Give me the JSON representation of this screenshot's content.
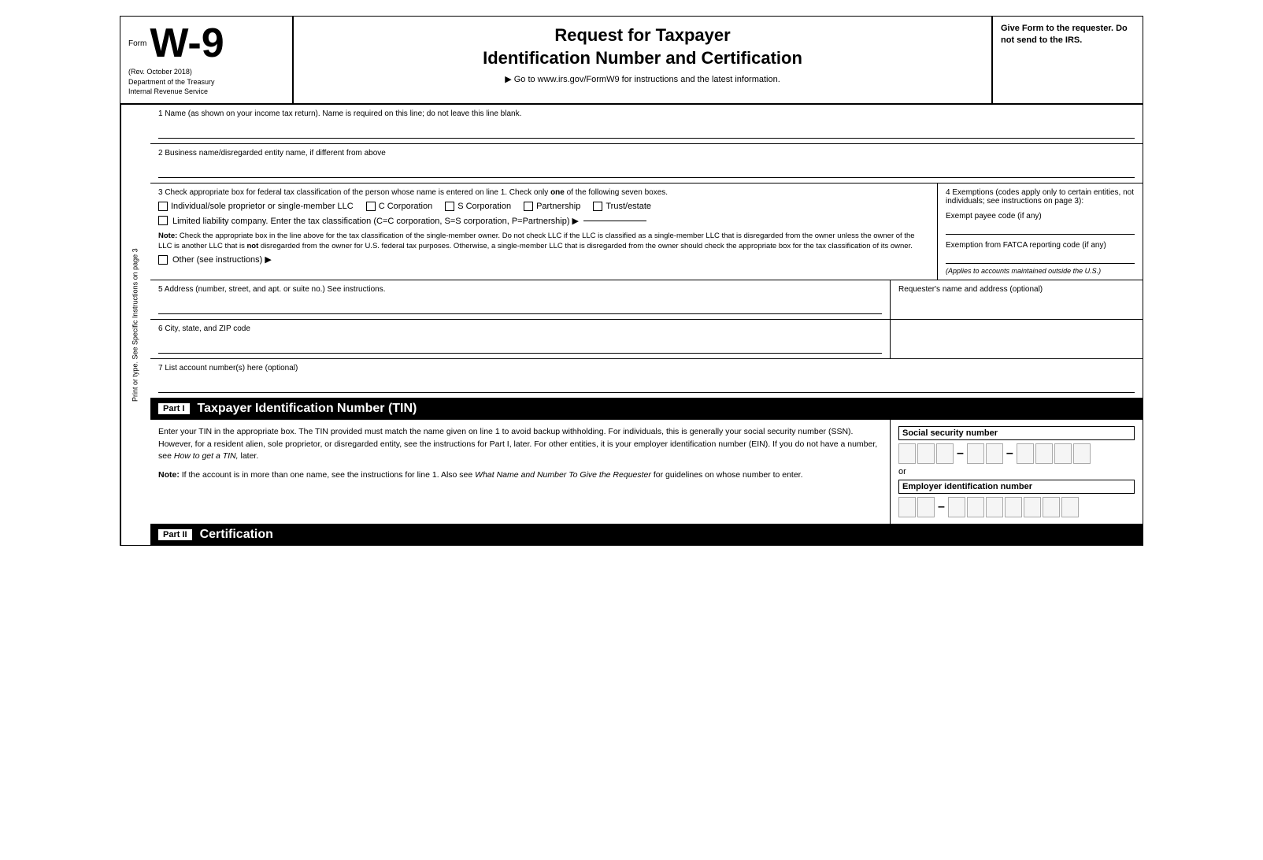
{
  "header": {
    "form_label": "Form",
    "form_number": "W-9",
    "rev": "(Rev. October 2018)",
    "dept1": "Department of the Treasury",
    "dept2": "Internal Revenue Service",
    "title_line1": "Request for Taxpayer",
    "title_line2": "Identification Number and Certification",
    "goto": "▶ Go to www.irs.gov/FormW9 for instructions and the latest information.",
    "give_form": "Give Form to the requester. Do not send to the IRS."
  },
  "sidebar": {
    "text": "Print or type. See Specific Instructions on page 3"
  },
  "fields": {
    "line1_label": "1  Name (as shown on your income tax return). Name is required on this line; do not leave this line blank.",
    "line2_label": "2  Business name/disregarded entity name, if different from above",
    "line3_label": "3  Check appropriate box for federal tax classification of the person whose name is entered on line 1. Check only",
    "line3_label_one": "one",
    "line3_label_end": "of the following seven boxes.",
    "cb_individual": "Individual/sole proprietor or single-member LLC",
    "cb_c_corp": "C Corporation",
    "cb_s_corp": "S Corporation",
    "cb_partnership": "Partnership",
    "cb_trust": "Trust/estate",
    "llc_label": "Limited liability company. Enter the tax classification (C=C corporation, S=S corporation, P=Partnership) ▶",
    "note_bold": "Note:",
    "note_text": " Check the appropriate box in the line above for the tax classification of the single-member owner.  Do not check LLC if the LLC is classified as a single-member LLC that is disregarded from the owner unless the owner of the LLC is another LLC that is",
    "note_not": "not",
    "note_text2": " disregarded from the owner for U.S. federal tax purposes. Otherwise, a single-member LLC that is disregarded from the owner should check the appropriate box for the tax classification of its owner.",
    "other_label": "Other (see instructions) ▶",
    "exemptions_label": "4  Exemptions (codes apply only to certain entities, not individuals; see instructions on page 3):",
    "exempt_payee_label": "Exempt payee code (if any)",
    "fatca_label": "Exemption from FATCA reporting code (if any)",
    "applies_note": "(Applies to accounts maintained outside the U.S.)",
    "line5_label": "5  Address (number, street, and apt. or suite no.) See instructions.",
    "requester_label": "Requester's name and address (optional)",
    "line6_label": "6  City, state, and ZIP code",
    "line7_label": "7  List account number(s) here (optional)"
  },
  "part1": {
    "badge": "Part I",
    "title": "Taxpayer Identification Number (TIN)",
    "body_text": "Enter your TIN in the appropriate box. The TIN provided must match the name given on line 1 to avoid backup withholding. For individuals, this is generally your social security number (SSN). However, for a resident alien, sole proprietor, or disregarded entity, see the instructions for Part I, later. For other entities, it is your employer identification number (EIN). If you do not have a number, see",
    "how_to_get": "How to get a TIN,",
    "body_text2": " later.",
    "note2_bold": "Note:",
    "note2_text": " If the account is in more than one name, see the instructions for line 1. Also see",
    "what_name": "What Name and Number To Give the Requester",
    "note2_text2": " for guidelines on whose number to enter.",
    "ssn_label": "Social security number",
    "or_text": "or",
    "ein_label": "Employer identification number"
  },
  "part2": {
    "badge": "Part II",
    "title": "Certification"
  }
}
